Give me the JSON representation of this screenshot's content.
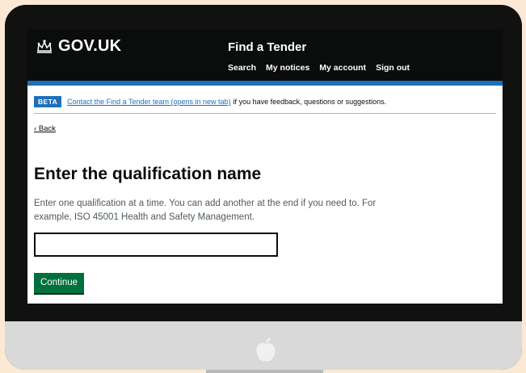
{
  "header": {
    "logo_text": "GOV.UK",
    "service_name": "Find a Tender",
    "nav": [
      "Search",
      "My notices",
      "My account",
      "Sign out"
    ]
  },
  "phase_banner": {
    "tag": "BETA",
    "link_text": "Contact the Find a Tender team (opens in new tab)",
    "text": "if you have feedback, questions or suggestions."
  },
  "back_link": "Back",
  "page": {
    "title": "Enter the qualification name",
    "hint": "Enter one qualification at a time. You can add another at the end if you need to. For example, ISO 45001 Health and Safety Management.",
    "input_value": ""
  },
  "continue_label": "Continue",
  "colors": {
    "header_bg": "#0b0c0c",
    "accent_blue": "#1d70b8",
    "button_green": "#00703c"
  }
}
